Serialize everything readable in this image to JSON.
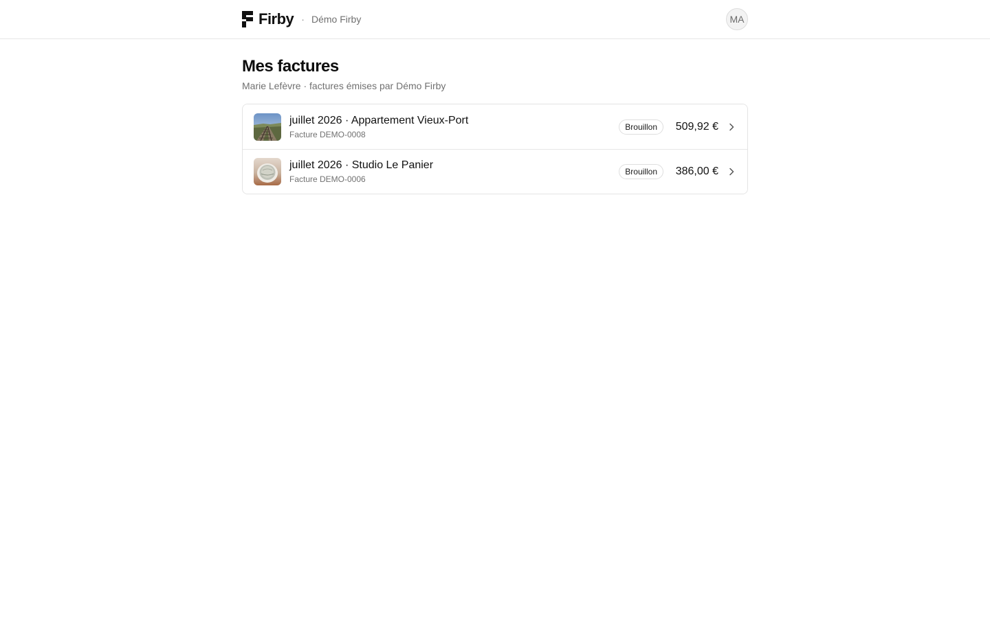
{
  "header": {
    "brand_name": "Firby",
    "separator": "·",
    "org_name": "Démo Firby",
    "avatar_initials": "MA"
  },
  "page": {
    "title": "Mes factures",
    "subtitle": "Marie Lefèvre · factures émises par Démo Firby"
  },
  "invoices": [
    {
      "title": "juillet 2026 · Appartement Vieux-Port",
      "number": "Facture DEMO-0008",
      "status": "Brouillon",
      "amount": "509,92 €",
      "thumbnail": "railway-landscape-photo"
    },
    {
      "title": "juillet 2026 · Studio Le Panier",
      "number": "Facture DEMO-0006",
      "status": "Brouillon",
      "amount": "386,00 €",
      "thumbnail": "coffee-cup-photo"
    }
  ],
  "icons": {
    "logo": "firby-logo-icon",
    "row_action": "chevron-right-icon"
  },
  "colors": {
    "text_primary": "#111111",
    "text_muted": "#707070",
    "border": "#e3e3e3"
  }
}
